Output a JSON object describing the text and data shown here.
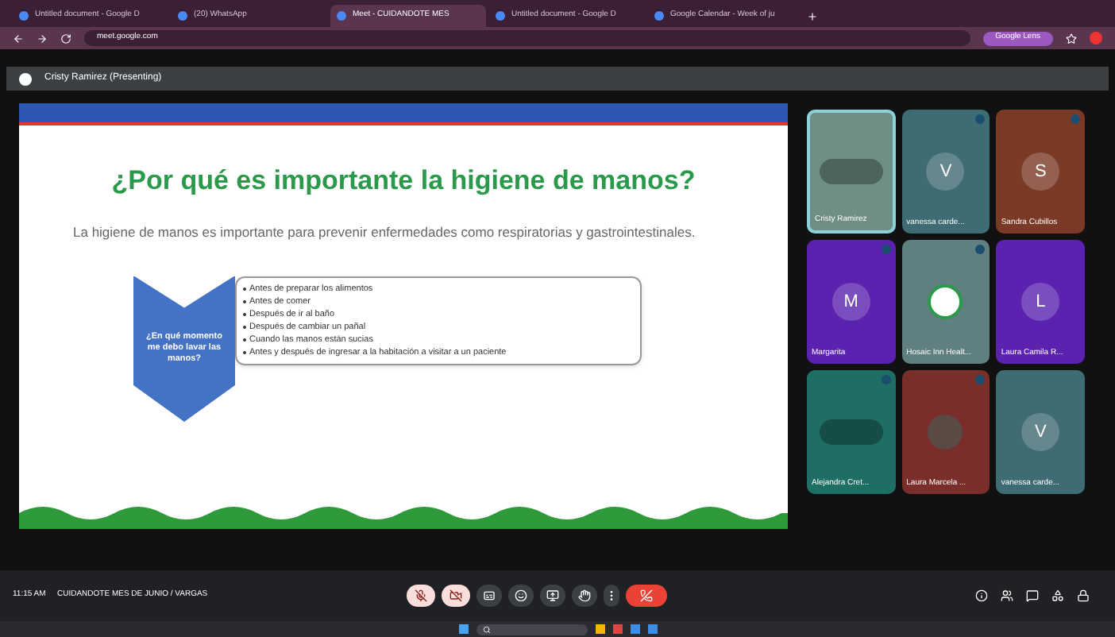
{
  "browser": {
    "tabs": [
      {
        "title": "Untitled document - Google D",
        "selected": false
      },
      {
        "title": "(20) WhatsApp",
        "selected": false
      },
      {
        "title": "Meet - CUIDANDOTE MES",
        "selected": true
      },
      {
        "title": "Untitled document - Google D",
        "selected": false
      },
      {
        "title": "Google Calendar - Week of ju",
        "selected": false
      }
    ],
    "url": "meet.google.com",
    "lens_label": "Google Lens"
  },
  "presenter_bar": {
    "label": "Cristy Ramirez (Presenting)"
  },
  "slide": {
    "title": "¿Por qué es importante la higiene de manos?",
    "paragraph": "La higiene de manos es importante para prevenir enfermedades como respiratorias y gastrointestinales.",
    "chevron_text": "¿En qué momento me debo lavar las manos?",
    "bullets": [
      "Antes de preparar los alimentos",
      "Antes de comer",
      "Después de ir al baño",
      "Después de cambiar un pañal",
      "Cuando las manos están sucias",
      "Antes y después de ingresar a la habitación a visitar a un paciente"
    ]
  },
  "participants": [
    {
      "name": "Cristy Ramirez",
      "kind": "image",
      "color": "#6f8f86",
      "speaking": true,
      "muted": false
    },
    {
      "name": "vanessa carde...",
      "kind": "letter",
      "letter": "V",
      "color": "#3f6b72",
      "speaking": false,
      "muted": true
    },
    {
      "name": "Sandra Cubillos",
      "kind": "letter",
      "letter": "S",
      "color": "#7a3a26",
      "speaking": false,
      "muted": true
    },
    {
      "name": "Margarita",
      "kind": "letter",
      "letter": "M",
      "color": "#5b22b0",
      "speaking": false,
      "muted": true
    },
    {
      "name": "Hosaic Inn Healt...",
      "kind": "logo",
      "color": "#5f7f80",
      "speaking": false,
      "muted": true
    },
    {
      "name": "Laura Camila R...",
      "kind": "letter",
      "letter": "L",
      "color": "#5b22b0",
      "speaking": false,
      "muted": false
    },
    {
      "name": "Alejandra Cret...",
      "kind": "image",
      "color": "#1f6e63",
      "speaking": false,
      "muted": true
    },
    {
      "name": "Laura Marcela ...",
      "kind": "photo",
      "color": "#7a2e2a",
      "speaking": false,
      "muted": true
    },
    {
      "name": "vanessa carde...",
      "kind": "letter",
      "letter": "V",
      "color": "#3f6b72",
      "speaking": false,
      "muted": false
    }
  ],
  "meeting_bar": {
    "time": "11:15 AM",
    "meeting_name": "CUIDANDOTE MES DE JUNIO / VARGAS",
    "mic_on": false,
    "camera_on": false
  }
}
